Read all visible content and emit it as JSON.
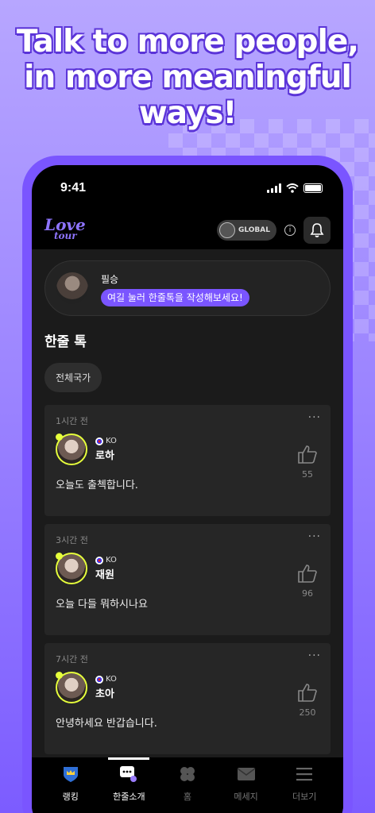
{
  "headline": [
    "Talk to more people,",
    "in more meaningful",
    "ways!"
  ],
  "status": {
    "time": "9:41"
  },
  "appbar": {
    "logo_line1": "Love",
    "logo_line2": "tour",
    "region_label": "GLOBAL",
    "info_label": "i"
  },
  "profile": {
    "name": "필승",
    "prompt": "여길 눌러 한줄톡을 작성해보세요!"
  },
  "section_title": "한줄 톡",
  "filter_chip": "전체국가",
  "posts": [
    {
      "time": "1시간 전",
      "country": "KO",
      "name": "로하",
      "text": "오늘도 출첵합니다.",
      "likes": "55"
    },
    {
      "time": "3시간 전",
      "country": "KO",
      "name": "재원",
      "text": "오늘 다들 뭐하시나요",
      "likes": "96"
    },
    {
      "time": "7시간 전",
      "country": "KO",
      "name": "초아",
      "text": "안녕하세요 반갑습니다.",
      "likes": "250"
    }
  ],
  "tabs": [
    {
      "label": "랭킹",
      "icon": "crown-shield-icon"
    },
    {
      "label": "한줄소개",
      "icon": "chat-bubble-icon",
      "active": true
    },
    {
      "label": "홈",
      "icon": "clover-icon"
    },
    {
      "label": "메세지",
      "icon": "mail-icon"
    },
    {
      "label": "더보기",
      "icon": "menu-icon"
    }
  ],
  "colors": {
    "accent": "#7a55ff",
    "highlight": "#e6ff3c",
    "background": "#1b1b1b"
  }
}
